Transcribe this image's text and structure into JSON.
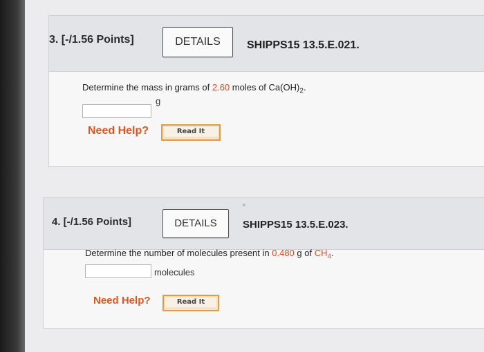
{
  "questions": [
    {
      "number_points": "3. [-/1.56 Points]",
      "details_label": "DETAILS",
      "code": "SHIPPS15 13.5.E.021.",
      "prompt_before": "Determine the mass in grams of ",
      "prompt_value": "2.60",
      "prompt_mid": " moles of Ca(OH)",
      "prompt_sub": "2",
      "prompt_end": ".",
      "answer_value": "",
      "unit": "g",
      "help_label": "Need Help?",
      "read_label": "Read It"
    },
    {
      "number_points": "4. [-/1.56 Points]",
      "details_label": "DETAILS",
      "code": "SHIPPS15 13.5.E.023.",
      "prompt_before": "Determine the number of molecules present in ",
      "prompt_value": "0.480",
      "prompt_mid": " g of ",
      "prompt_formula": "CH",
      "prompt_sub": "4",
      "prompt_end": ".",
      "answer_value": "",
      "unit": "molecules",
      "help_label": "Need Help?",
      "read_label": "Read It"
    }
  ],
  "colors": {
    "highlight": "#d2502a",
    "help": "#e0541e",
    "read_border": "#e39b4a"
  }
}
